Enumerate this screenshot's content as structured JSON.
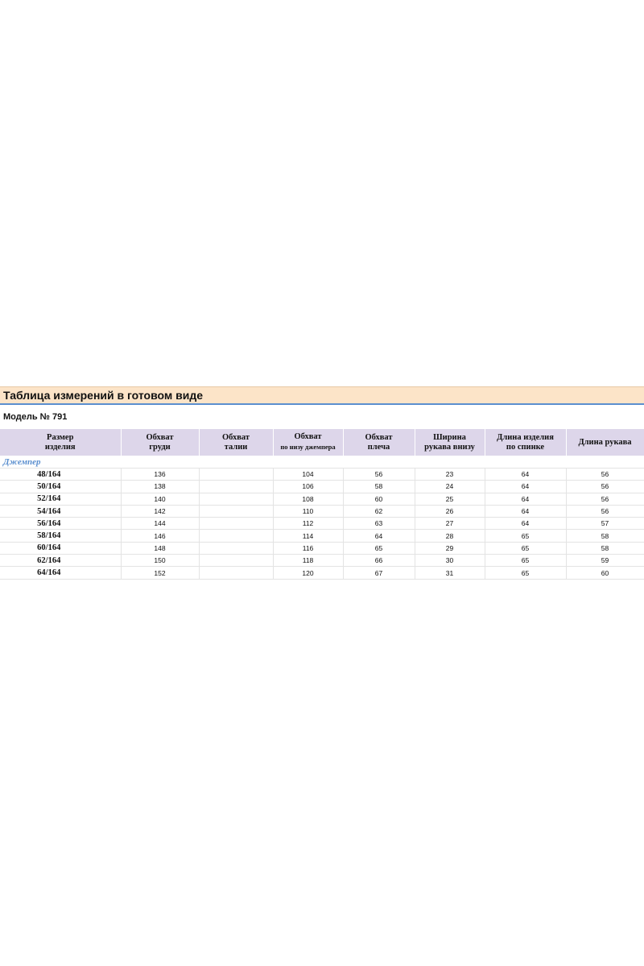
{
  "title": "Таблица измерений в готовом виде",
  "model": "Модель № 791",
  "headers": [
    {
      "line1": "Размер",
      "line2": "изделия",
      "small": false
    },
    {
      "line1": "Обхват",
      "line2": "груди",
      "small": false
    },
    {
      "line1": "Обхват",
      "line2": "талии",
      "small": false
    },
    {
      "line1": "Обхват",
      "line2": "по низу джемпера",
      "small": true
    },
    {
      "line1": "Обхват",
      "line2": "плеча",
      "small": false
    },
    {
      "line1": "Ширина",
      "line2": "рукава внизу",
      "small": false
    },
    {
      "line1": "Длина изделия",
      "line2": "по спинке",
      "small": false
    },
    {
      "line1": "Длина рукава",
      "line2": "",
      "small": false
    }
  ],
  "section": "Джемпер",
  "rows": [
    [
      "48/164",
      "136",
      "",
      "104",
      "56",
      "23",
      "64",
      "56"
    ],
    [
      "50/164",
      "138",
      "",
      "106",
      "58",
      "24",
      "64",
      "56"
    ],
    [
      "52/164",
      "140",
      "",
      "108",
      "60",
      "25",
      "64",
      "56"
    ],
    [
      "54/164",
      "142",
      "",
      "110",
      "62",
      "26",
      "64",
      "56"
    ],
    [
      "56/164",
      "144",
      "",
      "112",
      "63",
      "27",
      "64",
      "57"
    ],
    [
      "58/164",
      "146",
      "",
      "114",
      "64",
      "28",
      "65",
      "58"
    ],
    [
      "60/164",
      "148",
      "",
      "116",
      "65",
      "29",
      "65",
      "58"
    ],
    [
      "62/164",
      "150",
      "",
      "118",
      "66",
      "30",
      "65",
      "59"
    ],
    [
      "64/164",
      "152",
      "",
      "120",
      "67",
      "31",
      "65",
      "60"
    ]
  ]
}
